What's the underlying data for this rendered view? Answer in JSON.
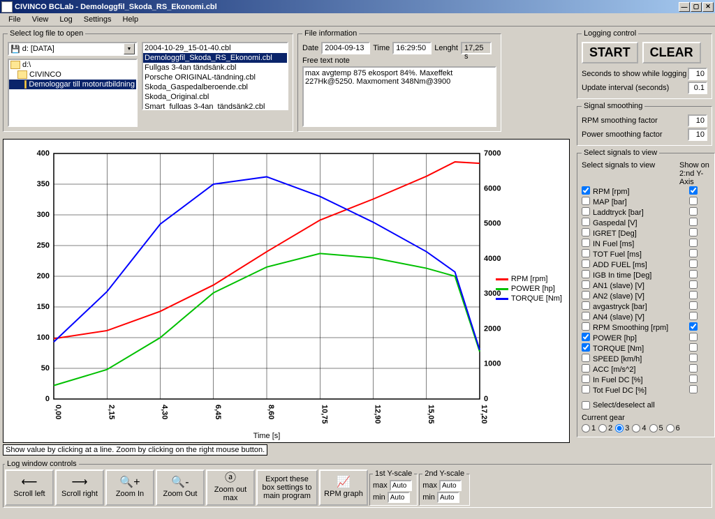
{
  "title": "CIVINCO  BCLab - Demologgfil_Skoda_RS_Ekonomi.cbl",
  "menu": [
    "File",
    "View",
    "Log",
    "Settings",
    "Help"
  ],
  "groups": {
    "select_log": "Select log file to open",
    "file_info": "File information",
    "logging_ctrl": "Logging control",
    "smoothing": "Signal smoothing",
    "signals": "Select signals to view",
    "log_window": "Log window controls"
  },
  "drive": "d: [DATA]",
  "folders": [
    "d:\\",
    "CIVINCO",
    "Demologgar till motorutbildning"
  ],
  "folder_selected_index": 2,
  "files": [
    "2004-10-29_15-01-40.cbl",
    "Demologgfil_Skoda_RS_Ekonomi.cbl",
    "Fullgas 3-4an tändsänk.cbl",
    "Porsche ORIGINAL-tändning.cbl",
    "Skoda_Gaspedalberoende.cbl",
    "Skoda_Original.cbl",
    "Smart_fullgas 3-4an_tändsänk2.cbl"
  ],
  "file_selected_index": 1,
  "file_info": {
    "date_label": "Date",
    "date": "2004-09-13",
    "time_label": "Time",
    "time": "16:29:50",
    "length_label": "Lenght",
    "length": "17,25 s",
    "note_label": "Free text note",
    "note": "max avgtemp 875 ekosport 84%. Maxeffekt 227Hk@5250. Maxmoment 348Nm@3900"
  },
  "logging": {
    "start": "START",
    "clear": "CLEAR",
    "seconds_label": "Seconds to show while logging",
    "seconds": "10",
    "interval_label": "Update interval (seconds)",
    "interval": "0.1"
  },
  "smoothing": {
    "rpm_label": "RPM smoothing factor",
    "rpm": "10",
    "power_label": "Power smoothing factor",
    "power": "10"
  },
  "signals": {
    "hdr1": "Select signals to view",
    "hdr2": "Show on 2:nd Y-Axis",
    "list": [
      {
        "label": "RPM [rpm]",
        "view": true,
        "y2": true
      },
      {
        "label": "MAP [bar]",
        "view": false,
        "y2": false
      },
      {
        "label": "Laddtryck [bar]",
        "view": false,
        "y2": false
      },
      {
        "label": "Gaspedal [V]",
        "view": false,
        "y2": false
      },
      {
        "label": "IGRET [Deg]",
        "view": false,
        "y2": false
      },
      {
        "label": "IN Fuel [ms]",
        "view": false,
        "y2": false
      },
      {
        "label": "TOT Fuel [ms]",
        "view": false,
        "y2": false
      },
      {
        "label": "ADD FUEL [ms]",
        "view": false,
        "y2": false
      },
      {
        "label": "IGB In time [Deg]",
        "view": false,
        "y2": false
      },
      {
        "label": "AN1 (slave) [V]",
        "view": false,
        "y2": false
      },
      {
        "label": "AN2 (slave) [V]",
        "view": false,
        "y2": false
      },
      {
        "label": "avgastryck [bar]",
        "view": false,
        "y2": false
      },
      {
        "label": "AN4 (slave) [V]",
        "view": false,
        "y2": false
      },
      {
        "label": "RPM Smoothing [rpm]",
        "view": false,
        "y2": true
      },
      {
        "label": "POWER [hp]",
        "view": true,
        "y2": false
      },
      {
        "label": "TORQUE [Nm]",
        "view": true,
        "y2": false
      },
      {
        "label": "SPEED [km/h]",
        "view": false,
        "y2": false
      },
      {
        "label": "ACC [m/s^2]",
        "view": false,
        "y2": false
      },
      {
        "label": "In Fuel DC [%]",
        "view": false,
        "y2": false
      },
      {
        "label": "Tot Fuel DC [%]",
        "view": false,
        "y2": false
      }
    ],
    "select_all": "Select/deselect all",
    "current_gear": "Current gear",
    "gears": [
      "1",
      "2",
      "3",
      "4",
      "5",
      "6"
    ],
    "gear_selected": "3"
  },
  "toolbar": {
    "scroll_left": "Scroll left",
    "scroll_right": "Scroll right",
    "zoom_in": "Zoom In",
    "zoom_out": "Zoom Out",
    "zoom_out_max": "Zoom out max",
    "export": "Export these box settings to main program",
    "rpm_graph": "RPM graph",
    "y1": "1st Y-scale",
    "y2": "2nd Y-scale",
    "max": "max",
    "min": "min",
    "auto": "Auto"
  },
  "chart_hint": "Show value by clicking at a line. Zoom by clicking on the right mouse button.",
  "chart_data": {
    "type": "line",
    "xlabel": "Time [s]",
    "xlim": [
      0,
      17.2
    ],
    "ylim_left": [
      0,
      400
    ],
    "ylim_right": [
      0,
      7000
    ],
    "x": [
      0.0,
      2.15,
      4.3,
      6.45,
      8.6,
      10.75,
      12.9,
      15.05,
      16.2,
      17.2
    ],
    "x_ticks": [
      "0,00",
      "2,15",
      "4,30",
      "6,45",
      "8,60",
      "10,75",
      "12,90",
      "15,05",
      "17,20"
    ],
    "y_left_ticks": [
      0,
      50,
      100,
      150,
      200,
      250,
      300,
      350,
      400
    ],
    "y_right_ticks": [
      0,
      1000,
      2000,
      3000,
      4000,
      5000,
      6000,
      7000
    ],
    "series": [
      {
        "name": "RPM [rpm]",
        "color": "#ff0000",
        "axis": "right",
        "values": [
          1720,
          1950,
          2500,
          3250,
          4200,
          5100,
          5700,
          6350,
          6760,
          6720
        ]
      },
      {
        "name": "POWER [hp]",
        "color": "#00c000",
        "axis": "left",
        "values": [
          22,
          48,
          100,
          173,
          215,
          237,
          230,
          213,
          200,
          77
        ]
      },
      {
        "name": "TORQUE [Nm]",
        "color": "#0000ff",
        "axis": "left",
        "values": [
          93,
          175,
          285,
          350,
          362,
          330,
          288,
          240,
          207,
          80
        ]
      }
    ]
  }
}
